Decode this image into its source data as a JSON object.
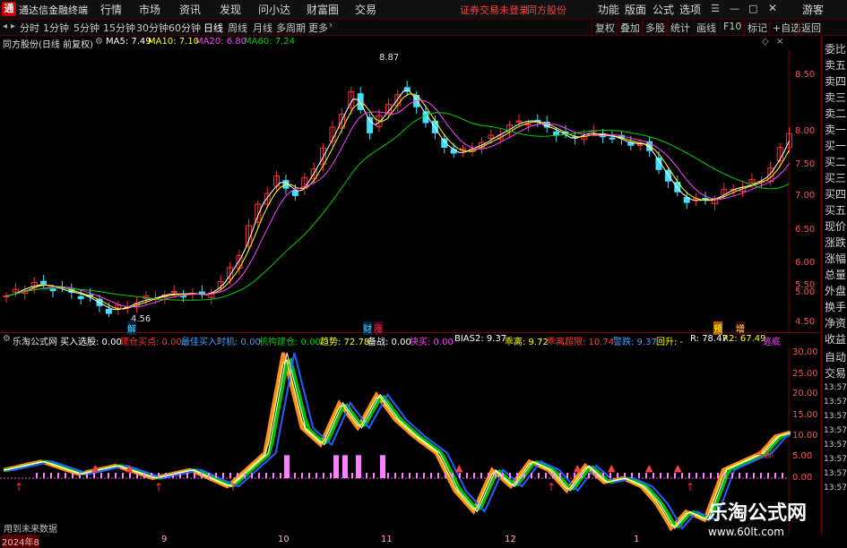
{
  "titlebar": {
    "app_name": "通达信金融终端",
    "menus": [
      "行情",
      "市场",
      "资讯",
      "发现",
      "问小达",
      "财富圈",
      "交易"
    ],
    "notice": "证券交易未登录",
    "notice2": "同方股份",
    "right_menus": [
      "功能",
      "版面",
      "公式",
      "选项"
    ],
    "guest": "游客"
  },
  "toolbar": {
    "periods": [
      "分时",
      "1分钟",
      "5分钟",
      "15分钟",
      "30分钟",
      "60分钟",
      "日线",
      "周线",
      "月线",
      "多周期",
      "更多"
    ],
    "active": "日线",
    "right": [
      "复权",
      "叠加",
      "多股",
      "统计",
      "画线",
      "F10",
      "标记",
      "+自选",
      "返回"
    ]
  },
  "infobar": {
    "title": "同方股份(日线 前复权)",
    "ma5": "MA5: 7.49",
    "ma10": "MA10: 7.10",
    "ma20": "MA20: 6.80",
    "ma60": "MA60: 7.24"
  },
  "price_axis": [
    "8.50",
    "8.00",
    "7.50",
    "7.00",
    "6.50",
    "6.00",
    "5.50",
    "5.00",
    "4.50"
  ],
  "price_annotations": {
    "high": "8.87",
    "low": "4.56",
    "jie": "解",
    "caiwu": "财",
    "zhang": "涨",
    "yu": "预",
    "zeng": "增"
  },
  "ind_bar": {
    "name": "乐淘公式网",
    "items": [
      {
        "label": "买入选股: 0.00",
        "color": "#ffffff"
      },
      {
        "label": "建仓买点: 0.00",
        "color": "#ff3030"
      },
      {
        "label": "最佳买入时机: 0.00",
        "color": "#40a0ff"
      },
      {
        "label": "机构建仓: 0.00",
        "color": "#00d000"
      },
      {
        "label": "趋势: 72.78",
        "color": "#ffff00"
      },
      {
        "label": "备战: 0.00",
        "color": "#ffffff"
      },
      {
        "label": "快买: 0.00",
        "color": "#ff40ff"
      },
      {
        "label": "BIAS2: 9.37",
        "color": "#ffffff"
      },
      {
        "label": "乖离: 9.72",
        "color": "#ffff00"
      },
      {
        "label": "乖离超限: 10.74",
        "color": "#ff4040"
      },
      {
        "label": "警跌: 9.37",
        "color": "#40a0ff"
      },
      {
        "label": "回升: -",
        "color": "#ffff00"
      },
      {
        "label": "R: 78.47",
        "color": "#ffffff"
      },
      {
        "label": "R2: 67.49",
        "color": "#ffff00"
      },
      {
        "label": "逃底",
        "color": "#ff40ff"
      }
    ]
  },
  "ind_axis": [
    "30.00",
    "25.00",
    "20.00",
    "15.00",
    "10.00",
    "5.00",
    "0.00"
  ],
  "ind_annotations": {
    "toubu": "头部",
    "left_label": "用到未来数据"
  },
  "dates": [
    "2024年8",
    "9",
    "10",
    "11",
    "12",
    "1"
  ],
  "sidebar": [
    "委比",
    "卖五",
    "卖四",
    "卖三",
    "卖二",
    "卖一",
    "买一",
    "买二",
    "买三",
    "买四",
    "买五",
    "现价",
    "涨跌",
    "涨幅",
    "总量",
    "外盘",
    "换手",
    "净资",
    "收益",
    "自动",
    "交易"
  ],
  "sidebar_times": [
    "13:57",
    "13:57",
    "13:57",
    "13:57",
    "13:57",
    "13:57",
    "13:57",
    "13:57"
  ],
  "watermark": {
    "main": "乐淘公式网",
    "url": "www.60lt.com"
  },
  "colors": {
    "up": "#ff3030",
    "down": "#40e0ff",
    "ma5": "#ffffff",
    "ma10": "#ffff00",
    "ma20": "#ff40ff",
    "ma60": "#00d000"
  }
}
